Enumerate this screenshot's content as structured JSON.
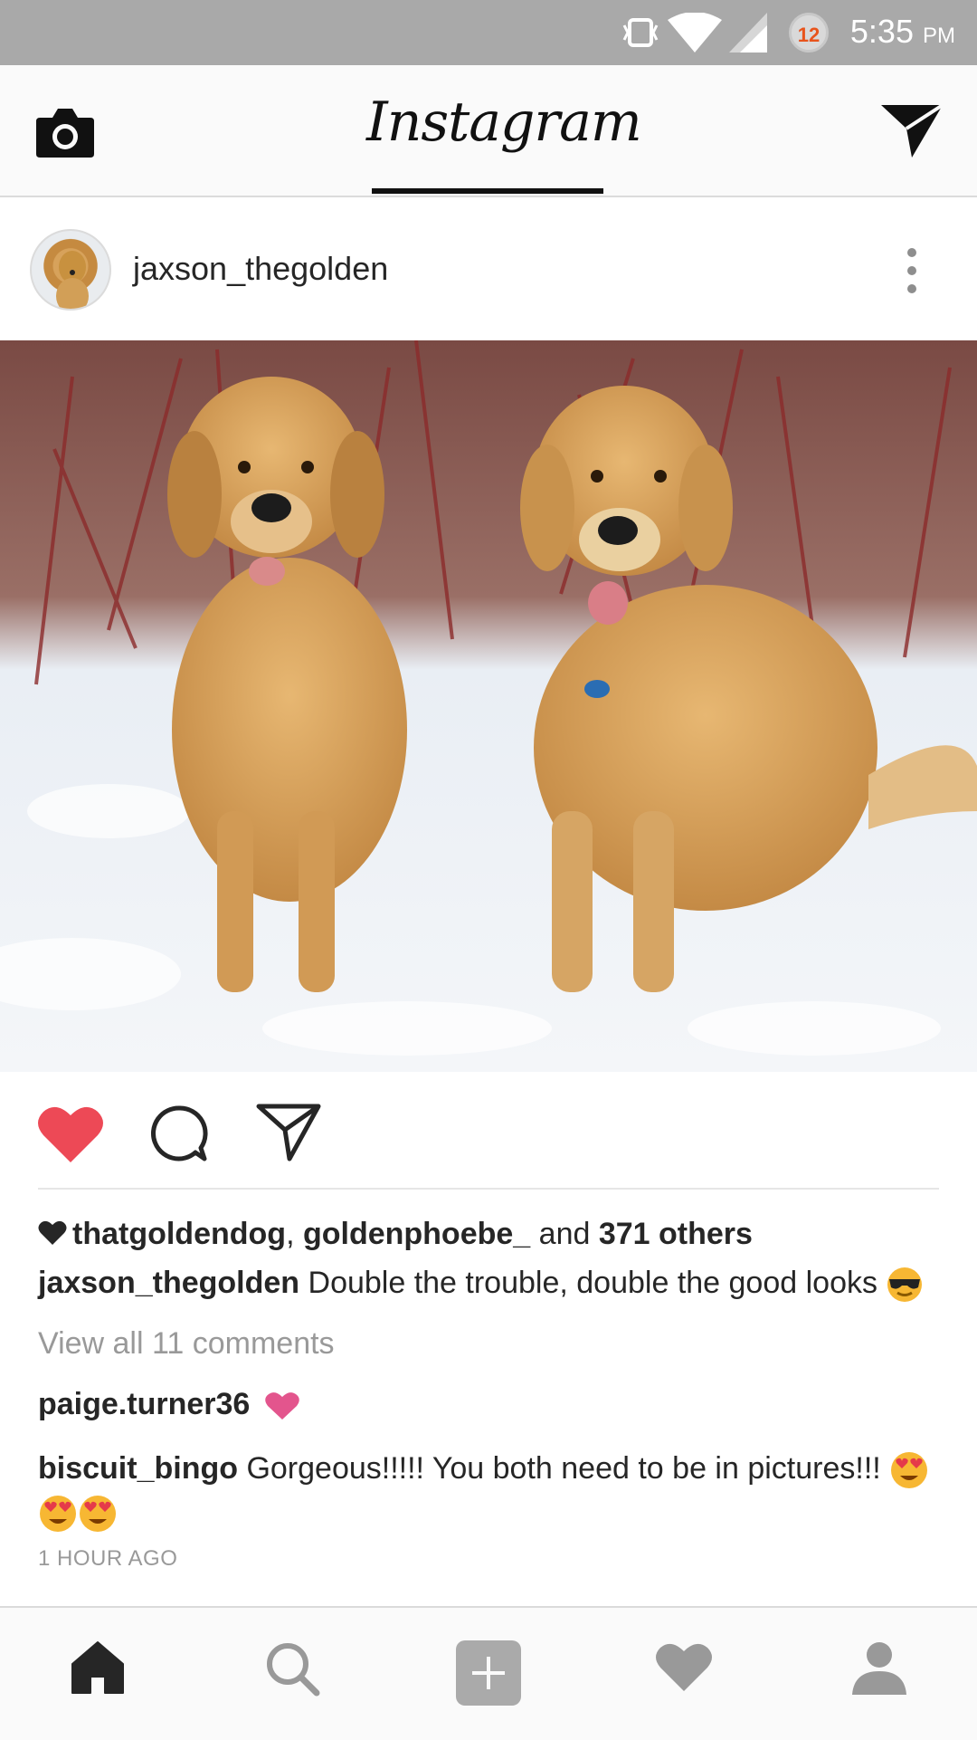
{
  "status_bar": {
    "time": "5:35",
    "ampm": "PM",
    "notification_count": "12",
    "icons": [
      "vibrate-icon",
      "wifi-icon",
      "signal-icon"
    ]
  },
  "header": {
    "title": "Instagram",
    "left_icon": "camera-icon",
    "right_icon": "direct-message-icon"
  },
  "post": {
    "username": "jaxson_thegolden",
    "photo_description_icon": "two-golden-retrievers-photo",
    "liked": true,
    "likes": {
      "user1": "thatgoldendog",
      "sep": ",",
      "user2": "goldenphoebe_",
      "and": "and",
      "others": "371 others"
    },
    "caption": {
      "username": "jaxson_thegolden",
      "text": "Double the trouble, double the good looks"
    },
    "view_all": "View all 11 comments",
    "comments": [
      {
        "username": "paige.turner36",
        "text": ""
      },
      {
        "username": "biscuit_bingo",
        "text": "Gorgeous!!!!! You both need to be in pictures!!!"
      }
    ],
    "timestamp": "1 HOUR AGO"
  },
  "bottom_nav": [
    "home-icon",
    "search-icon",
    "add-post-icon",
    "activity-heart-icon",
    "profile-icon"
  ],
  "colors": {
    "like_red": "#ed4956",
    "header_bg": "#fafafa",
    "status_bg": "#a9a9a9",
    "secondary_text": "#999999"
  }
}
